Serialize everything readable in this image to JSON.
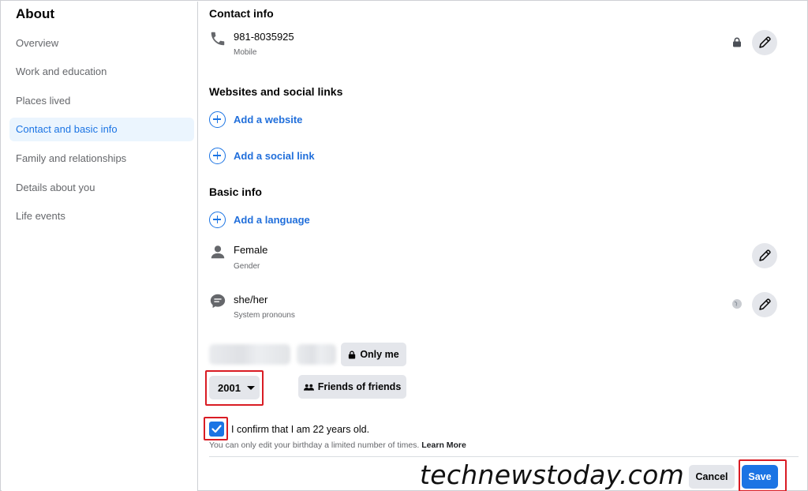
{
  "sidebar": {
    "title": "About",
    "items": [
      {
        "label": "Overview"
      },
      {
        "label": "Work and education"
      },
      {
        "label": "Places lived"
      },
      {
        "label": "Contact and basic info",
        "active": true
      },
      {
        "label": "Family and relationships"
      },
      {
        "label": "Details about you"
      },
      {
        "label": "Life events"
      }
    ]
  },
  "contact": {
    "title": "Contact info",
    "phone": {
      "value": "981-8035925",
      "type": "Mobile",
      "icon": "phone-icon",
      "privacy_icon": "lock-icon"
    }
  },
  "websites": {
    "title": "Websites and social links",
    "add_website": "Add a website",
    "add_social": "Add a social link"
  },
  "basic": {
    "title": "Basic info",
    "add_language": "Add a language",
    "gender": {
      "value": "Female",
      "label": "Gender",
      "icon": "person-icon"
    },
    "pronouns": {
      "value": "she/her",
      "label": "System pronouns",
      "icon": "chat-bubble-icon",
      "privacy_icon": "globe-icon"
    }
  },
  "birthday": {
    "privacy_date": "Only me",
    "year": "2001",
    "privacy_year": "Friends of friends",
    "confirm_text": "I confirm that I am 22 years old.",
    "note": "You can only edit your birthday a limited number of times.",
    "learn_more": "Learn More",
    "checked": true
  },
  "footer": {
    "cancel": "Cancel",
    "save": "Save"
  },
  "watermark": "technewstoday.com",
  "colors": {
    "accent": "#1b74e4",
    "highlight_box": "#d91c24",
    "button_gray": "#e4e6eb"
  }
}
